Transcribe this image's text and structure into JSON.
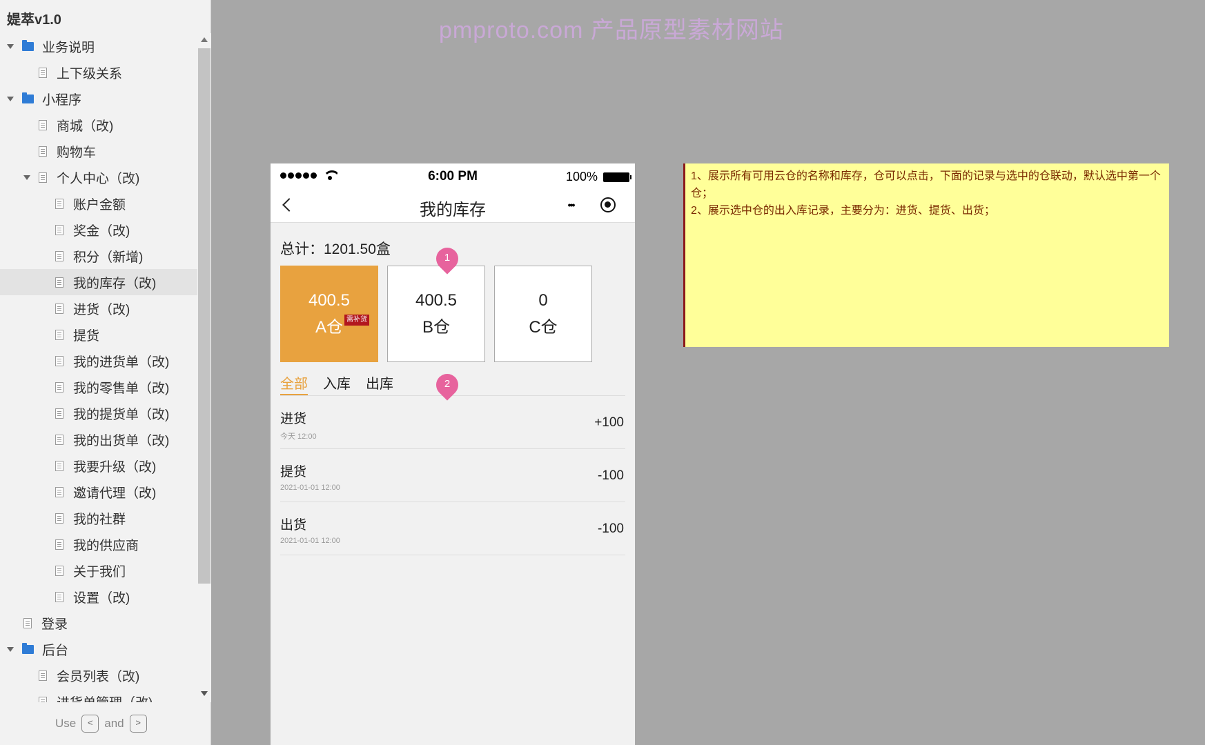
{
  "app": {
    "title": "媞萃v1.0"
  },
  "sidebar": {
    "items": [
      {
        "label": "业务说明",
        "kind": "folder",
        "expanded": true,
        "depth": 0
      },
      {
        "label": "上下级关系",
        "kind": "page",
        "depth": 1
      },
      {
        "label": "小程序",
        "kind": "folder",
        "expanded": true,
        "depth": 0
      },
      {
        "label": "商城（改)",
        "kind": "page",
        "depth": 1
      },
      {
        "label": "购物车",
        "kind": "page",
        "depth": 1
      },
      {
        "label": "个人中心（改)",
        "kind": "page",
        "expanded": true,
        "depth": 1
      },
      {
        "label": "账户金额",
        "kind": "page",
        "depth": 2
      },
      {
        "label": "奖金（改)",
        "kind": "page",
        "depth": 2
      },
      {
        "label": "积分（新增)",
        "kind": "page",
        "depth": 2
      },
      {
        "label": "我的库存（改)",
        "kind": "page",
        "depth": 2,
        "selected": true
      },
      {
        "label": "进货（改)",
        "kind": "page",
        "depth": 2
      },
      {
        "label": "提货",
        "kind": "page",
        "depth": 2
      },
      {
        "label": "我的进货单（改)",
        "kind": "page",
        "depth": 2
      },
      {
        "label": "我的零售单（改)",
        "kind": "page",
        "depth": 2
      },
      {
        "label": "我的提货单（改)",
        "kind": "page",
        "depth": 2
      },
      {
        "label": "我的出货单（改)",
        "kind": "page",
        "depth": 2
      },
      {
        "label": "我要升级（改)",
        "kind": "page",
        "depth": 2
      },
      {
        "label": "邀请代理（改)",
        "kind": "page",
        "depth": 2
      },
      {
        "label": "我的社群",
        "kind": "page",
        "depth": 2
      },
      {
        "label": "我的供应商",
        "kind": "page",
        "depth": 2
      },
      {
        "label": "关于我们",
        "kind": "page",
        "depth": 2
      },
      {
        "label": "设置（改)",
        "kind": "page",
        "depth": 2
      },
      {
        "label": "登录",
        "kind": "page",
        "depth": 0.5
      },
      {
        "label": "后台",
        "kind": "folder",
        "expanded": true,
        "depth": 0
      },
      {
        "label": "会员列表（改)",
        "kind": "page",
        "depth": 1
      },
      {
        "label": "进货单管理（改)",
        "kind": "page",
        "depth": 1
      }
    ],
    "hint": {
      "use": "Use",
      "and": "and",
      "key_prev": "<",
      "key_next": ">"
    }
  },
  "watermark": "pmproto.com 产品原型素材网站",
  "phone": {
    "status": {
      "time": "6:00 PM",
      "battery": "100%"
    },
    "nav": {
      "title": "我的库存",
      "more": "•••"
    },
    "total": "总计：1201.50盒",
    "warehouses": [
      {
        "qty": "400.5",
        "name": "A仓",
        "badge": "需补货",
        "active": true
      },
      {
        "qty": "400.5",
        "name": "B仓"
      },
      {
        "qty": "0",
        "name": "C仓"
      }
    ],
    "tabs": [
      {
        "label": "全部",
        "active": true
      },
      {
        "label": "入库"
      },
      {
        "label": "出库"
      }
    ],
    "pins": [
      "1",
      "2"
    ],
    "records": [
      {
        "type": "进货",
        "time": "今天 12:00",
        "amount": "+100"
      },
      {
        "type": "提货",
        "time": "2021-01-01 12:00",
        "amount": "-100"
      },
      {
        "type": "出货",
        "time": "2021-01-01 12:00",
        "amount": "-100"
      }
    ]
  },
  "note": {
    "line1": "1、展示所有可用云仓的名称和库存，仓可以点击，下面的记录与选中的仓联动，默认选中第一个仓；",
    "line2": "2、展示选中仓的出入库记录，主要分为：进货、提货、出货；"
  },
  "colors": {
    "accent": "#e8a23f",
    "pin": "#e7639d",
    "badge": "#b2161e",
    "note_bg": "#ffff99",
    "folder": "#2f7cd6"
  }
}
